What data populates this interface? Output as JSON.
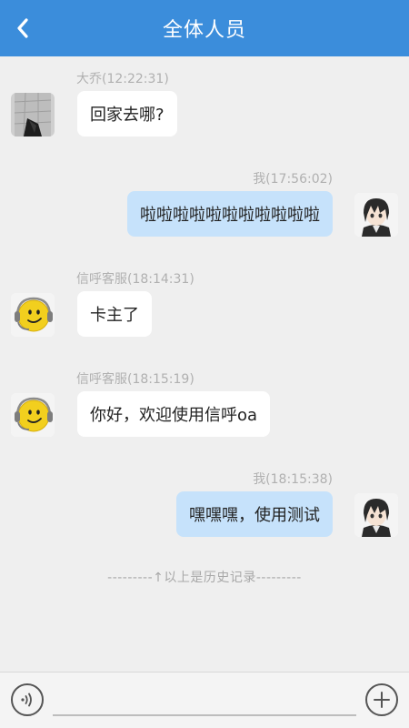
{
  "header": {
    "title": "全体人员",
    "back_icon": "chevron-left-icon",
    "background": "#3b8ddb"
  },
  "messages": [
    {
      "sender": "大乔",
      "time_label": "大乔(12:22:31)",
      "text": "回家去哪?",
      "side": "left",
      "avatar": "photo-avatar"
    },
    {
      "sender": "我",
      "time_label": "我(17:56:02)",
      "text": "啦啦啦啦啦啦啦啦啦啦啦",
      "side": "right",
      "avatar": "anime-avatar"
    },
    {
      "sender": "信呼客服",
      "time_label": "信呼客服(18:14:31)",
      "text": "卡主了",
      "side": "left",
      "avatar": "support-smiley-avatar"
    },
    {
      "sender": "信呼客服",
      "time_label": "信呼客服(18:15:19)",
      "text": "你好，欢迎使用信呼oa",
      "side": "left",
      "avatar": "support-smiley-avatar"
    },
    {
      "sender": "我",
      "time_label": "我(18:15:38)",
      "text": "嘿嘿嘿，使用测试",
      "side": "right",
      "avatar": "anime-avatar"
    }
  ],
  "history_divider": "---------↑以上是历史记录---------",
  "input_bar": {
    "voice_icon": "voice-icon",
    "add_icon": "plus-icon",
    "placeholder": ""
  },
  "colors": {
    "outgoing_bubble": "#c6e2fb",
    "incoming_bubble": "#ffffff",
    "background": "#efefef"
  }
}
